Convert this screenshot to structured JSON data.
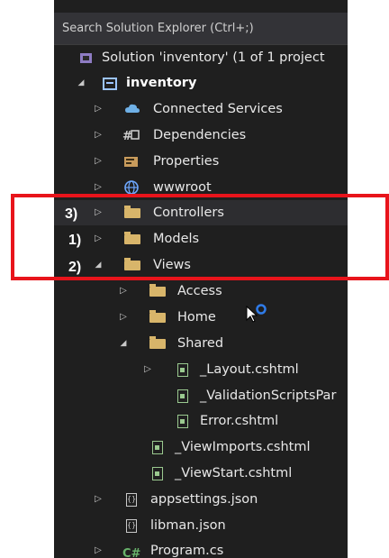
{
  "search": {
    "placeholder": "Search Solution Explorer (Ctrl+;)"
  },
  "tree": {
    "solution": "Solution 'inventory' (1 of 1 project",
    "project": "inventory",
    "items": [
      {
        "label": "Connected Services"
      },
      {
        "label": "Dependencies"
      },
      {
        "label": "Properties"
      },
      {
        "label": "wwwroot"
      },
      {
        "label": "Controllers"
      },
      {
        "label": "Models"
      },
      {
        "label": "Views"
      },
      {
        "label": "Access"
      },
      {
        "label": "Home"
      },
      {
        "label": "Shared"
      },
      {
        "label": "_Layout.cshtml"
      },
      {
        "label": "_ValidationScriptsPar"
      },
      {
        "label": "Error.cshtml"
      },
      {
        "label": "_ViewImports.cshtml"
      },
      {
        "label": "_ViewStart.cshtml"
      },
      {
        "label": "appsettings.json"
      },
      {
        "label": "libman.json"
      },
      {
        "label": "Program.cs"
      }
    ]
  },
  "annotations": {
    "step1": "1)",
    "step2": "2)",
    "step3": "3)"
  },
  "icons": {
    "connected_services": "cloud-icon",
    "dependencies": "dependencies-icon",
    "properties": "wrench-icon",
    "wwwroot": "globe-icon",
    "folder": "folder-icon",
    "cshtml": "razor-file-icon",
    "json": "json-file-icon",
    "csharp": "csharp-icon"
  },
  "colors": {
    "panel_bg": "#1f1f1f",
    "highlight_box": "#e8141b",
    "folder": "#d8b56a",
    "cshtml": "#9ac98f",
    "cursor_ring": "#2f7be8"
  }
}
